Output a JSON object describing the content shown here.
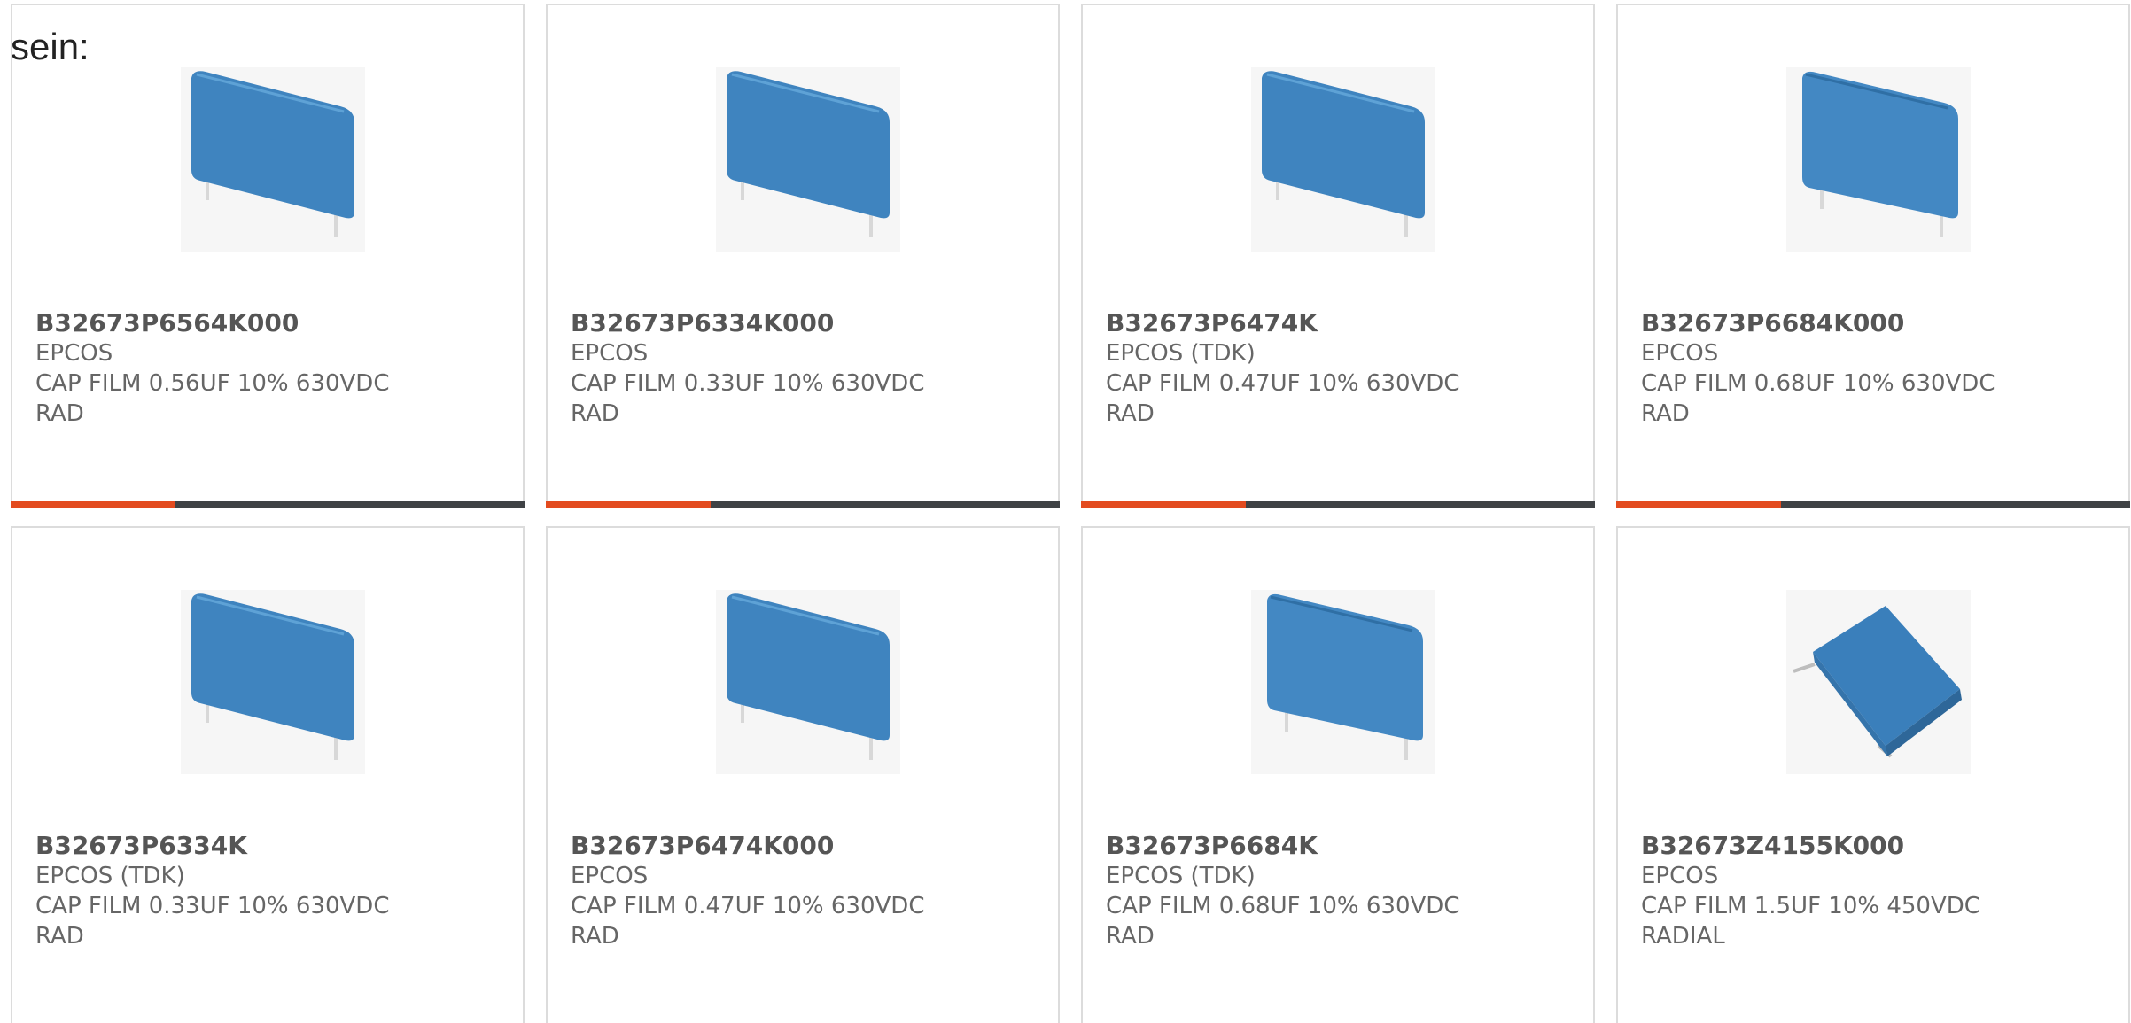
{
  "intro_text": "sein:",
  "accent_color": "#e34b1f",
  "bar_color": "#3f4245",
  "products": [
    {
      "part": "B32673P6564K000",
      "brand": "EPCOS",
      "desc": "CAP FILM 0.56UF 10% 630VDC",
      "lead": "RAD",
      "image_icon": "film-capacitor-icon",
      "progress": 0.32
    },
    {
      "part": "B32673P6334K000",
      "brand": "EPCOS",
      "desc": "CAP FILM 0.33UF 10% 630VDC",
      "lead": "RAD",
      "image_icon": "film-capacitor-icon",
      "progress": 0.32
    },
    {
      "part": "B32673P6474K",
      "brand": "EPCOS (TDK)",
      "desc": "CAP FILM 0.47UF 10% 630VDC",
      "lead": "RAD",
      "image_icon": "film-capacitor-icon",
      "progress": 0.32
    },
    {
      "part": "B32673P6684K000",
      "brand": "EPCOS",
      "desc": "CAP FILM 0.68UF 10% 630VDC",
      "lead": "RAD",
      "image_icon": "film-capacitor-icon",
      "progress": 0.32
    },
    {
      "part": "B32673P6334K",
      "brand": "EPCOS (TDK)",
      "desc": "CAP FILM 0.33UF 10% 630VDC",
      "lead": "RAD",
      "image_icon": "film-capacitor-icon"
    },
    {
      "part": "B32673P6474K000",
      "brand": "EPCOS",
      "desc": "CAP FILM 0.47UF 10% 630VDC",
      "lead": "RAD",
      "image_icon": "film-capacitor-icon"
    },
    {
      "part": "B32673P6684K",
      "brand": "EPCOS (TDK)",
      "desc": "CAP FILM 0.68UF 10% 630VDC",
      "lead": "RAD",
      "image_icon": "film-capacitor-icon"
    },
    {
      "part": "B32673Z4155K000",
      "brand": "EPCOS",
      "desc": "CAP FILM 1.5UF 10% 450VDC",
      "lead": "RADIAL",
      "image_icon": "film-capacitor-icon"
    }
  ]
}
